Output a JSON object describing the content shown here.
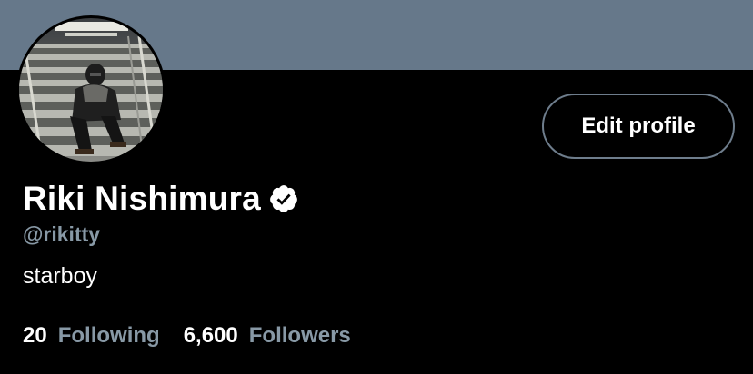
{
  "profile": {
    "banner_color": "#66788a",
    "display_name": "Riki Nishimura",
    "verified": true,
    "handle": "@rikitty",
    "bio": "starboy",
    "edit_button_label": "Edit profile",
    "avatar_description": "person-sitting-on-stairs-photo",
    "stats": [
      {
        "count": "20",
        "label": "Following"
      },
      {
        "count": "6,600",
        "label": "Followers"
      }
    ]
  },
  "colors": {
    "background": "#000000",
    "text_primary": "#ffffff",
    "text_secondary": "#8899a6",
    "button_border": "#6e7d8c"
  },
  "icons": {
    "verified": "verified-badge-icon"
  }
}
